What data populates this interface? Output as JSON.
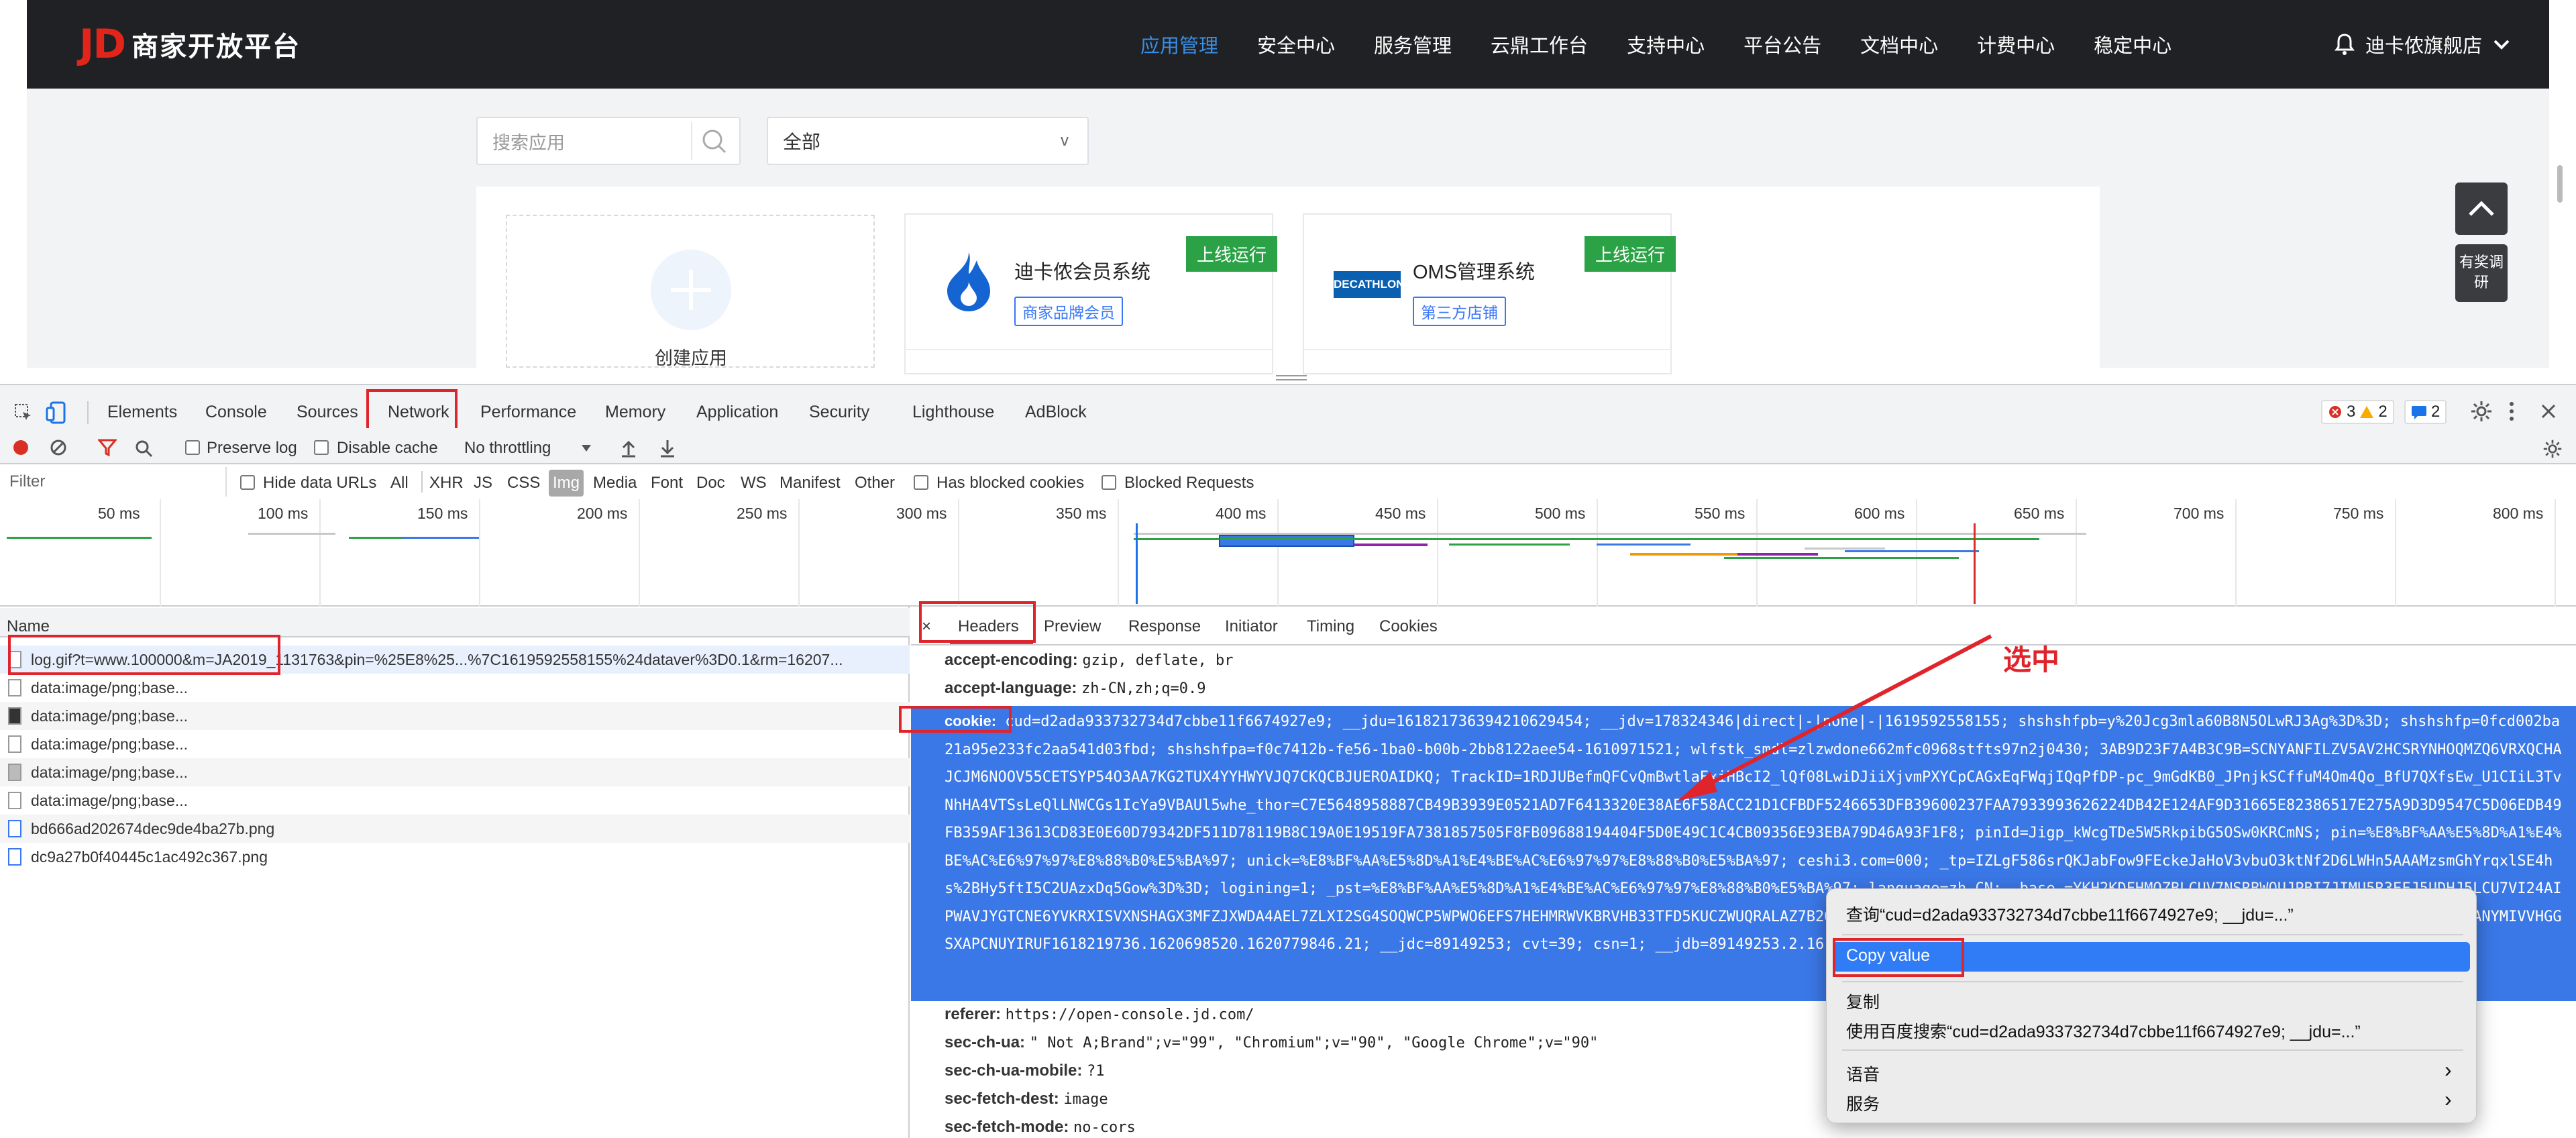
{
  "topnav": {
    "logo_mark": "JD",
    "logo_text": "商家开放平台",
    "items": [
      "应用管理",
      "安全中心",
      "服务管理",
      "云鼎工作台",
      "支持中心",
      "平台公告",
      "文档中心",
      "计费中心",
      "稳定中心"
    ],
    "active_index": 0,
    "user_name": "迪卡侬旗舰店"
  },
  "page": {
    "search_placeholder": "搜索应用",
    "filter_value": "全部",
    "filter_arrow": "v",
    "create_label": "创建应用",
    "apps": [
      {
        "title": "迪卡侬会员系统",
        "tag": "商家品牌会员",
        "status": "上线运行"
      },
      {
        "title": "OMS管理系统",
        "tag": "第三方店铺",
        "status": "上线运行",
        "logo_text": "DECATHLON"
      }
    ],
    "float_survey": "有奖调研"
  },
  "devtools": {
    "tabs": [
      "Elements",
      "Console",
      "Sources",
      "Network",
      "Performance",
      "Memory",
      "Application",
      "Security",
      "Lighthouse",
      "AdBlock"
    ],
    "active_tab": "Network",
    "badges": {
      "errors": "3",
      "warnings": "2",
      "info": "2"
    },
    "toolbar": {
      "preserve_log": "Preserve log",
      "disable_cache": "Disable cache",
      "throttling": "No throttling"
    },
    "filter": {
      "placeholder": "Filter",
      "hide_data_urls": "Hide data URLs",
      "types": [
        "All",
        "XHR",
        "JS",
        "CSS",
        "Img",
        "Media",
        "Font",
        "Doc",
        "WS",
        "Manifest",
        "Other"
      ],
      "active_type": "Img",
      "has_blocked_cookies": "Has blocked cookies",
      "blocked_requests": "Blocked Requests"
    },
    "timeline_ticks": [
      "50 ms",
      "100 ms",
      "150 ms",
      "200 ms",
      "250 ms",
      "300 ms",
      "350 ms",
      "400 ms",
      "450 ms",
      "500 ms",
      "550 ms",
      "600 ms",
      "650 ms",
      "700 ms",
      "750 ms",
      "800 ms"
    ],
    "name_header": "Name",
    "requests": [
      "log.gif?t=www.100000&m=JA2019_1131763&pin=%25E8%25...%7C1619592558155%24dataver%3D0.1&rm=16207...",
      "data:image/png;base...",
      "data:image/png;base...",
      "data:image/png;base...",
      "data:image/png;base...",
      "data:image/png;base...",
      "bd666ad202674dec9de4ba27b.png",
      "dc9a27b0f40445c1ac492c367.png"
    ],
    "detail_close": "×",
    "detail_tabs": [
      "Headers",
      "Preview",
      "Response",
      "Initiator",
      "Timing",
      "Cookies"
    ],
    "detail_active": "Headers",
    "headers_before": [
      {
        "key": "accept-encoding:",
        "value": "gzip, deflate, br"
      },
      {
        "key": "accept-language:",
        "value": "zh-CN,zh;q=0.9"
      }
    ],
    "cookie_key": "cookie:",
    "cookie_value": "cud=d2ada933732734d7cbbe11f6674927e9; __jdu=1618217363942106294​54; __jdv=178324346|direct|-|none|-|1619592558155; shshshfpb=y%20Jcg3mla60B8N5OLwRJ3Ag%3D%3D; shshshfp=0fcd002ba21a95e233fc2aa541d03fbd; shshshfpa=f0c7412b-fe56-1ba0-b00b-2bb8122aee54-1610971521; wlfstk_smdl=zlzwdone662mfc0968stfts97n2j0430; 3AB9D23F7A4B3C9B=SCNYANFILZV5AV2HCSRYNHOQMZQ6VRXQCHAJCJM6NOOV55CETSYP54O3AA7KG2TUX4YYHWYVJQ7CKQCBJUEROAIDKQ; TrackID=1RDJUBefmQFCvQmBwtlaExiHBcI2_lQf08LwiDJiiXjvmPXYCpCAGxEqFWqjIQqPfDP-pc_9mGdKB0_JPnjkSCffuM4Om4Qo_BfU7QXfsEw_U1CIiL3TvNhHA4VTSsLeQlLNWCGs1IcYa9VBAUl5whe_thor=C7E5648958887CB49B3939E0521AD7F6413320E38AE6F58ACC21D1CFBDF5246653DFB39600237FAA7933993626224DB42E124AF9D31665E82386517E275A9D3D9547C5D06EDB49FB359AF13613CD83E0E60D79342DF511D78119B8C19A0E19519FA7381857505F8FB09688194404F5D0E49C1C4CB09356E93EBA79D46A93F1F8; pinId=Jigp_kWcgTDe5W5RkpibG5OSw0KRCmNS; pin=%E8%BF%AA%E5%8D%A1%E4%BE%AC%E6%97%97%E8%88%B0%E5%BA%97; unick=%E8%BF%AA%E5%8D%A1%E4%BE%AC%E6%97%97%E8%88%B0%E5%BA%97; ceshi3.com=000; _tp=IZLgF586srQKJabFow9FEckeJaHoV3vbuO3ktNf2D6LWHn5AAAMzsmGhYrqxlSE4hs%2BHy5ftI5C2UAzxDq5Gow%3D%3D; logining=1; _pst=%E8%BF%AA%E5%8D%A1%E4%BE%AC%E6%97%97%E8%88%B0%E5%BA%97; language=zh_CN; _base_=YKH2KDFHMOZBLCUV7NSRBWQUJPBI7JIMU5R3EFJ5UDHJ5LCU7VI24AIPWAVJYGTCNE6YVKRXISVXNSHAGX3MFZJXWDA4AEL7ZLXI2SG4SOQWCP5WPWO6EFS7HEHMRWVKBRVHB33TFD5KUCZWUQRALAZ7B2OCRDR3C3YZUY3EZIG23S7DJGYJCXICD3ZAI4ZR4B4NENJKQN73MYODU2FWYFUCUKP2QADJETIANYMIVVHGGSXAPCNUYIRUF1618219736.1620698520.1620779846.21; __jdc=89149253; cvt=39; csn=1; __jdb=89149253.2.16182197363942",
    "headers_after": [
      {
        "key": "referer:",
        "value": "https://open-console.jd.com/"
      },
      {
        "key": "sec-ch-ua:",
        "value": "\" Not A;Brand\";v=\"99\", \"Chromium\";v=\"90\", \"Google Chrome\";v=\"90\""
      },
      {
        "key": "sec-ch-ua-mobile:",
        "value": "?1"
      },
      {
        "key": "sec-fetch-dest:",
        "value": "image"
      },
      {
        "key": "sec-fetch-mode:",
        "value": "no-cors"
      }
    ]
  },
  "context_menu": {
    "lookup": "查询“cud=d2ada933732734d7cbbe11f6674927e9; __jdu=...”",
    "copy_value": "Copy value",
    "copy": "复制",
    "baidu_search": "使用百度搜索“cud=d2ada933732734d7cbbe11f6674927e9; __jdu=...”",
    "speech": "语音",
    "services": "服务",
    "submenu_arrow": "›"
  },
  "annotation": {
    "label": "选中"
  },
  "colors": {
    "accent": "#3a77f5",
    "nav_bg": "#1f2124",
    "status_green": "#2aa245",
    "selection": "#3b78e7",
    "annotation_red": "#e0242b"
  }
}
